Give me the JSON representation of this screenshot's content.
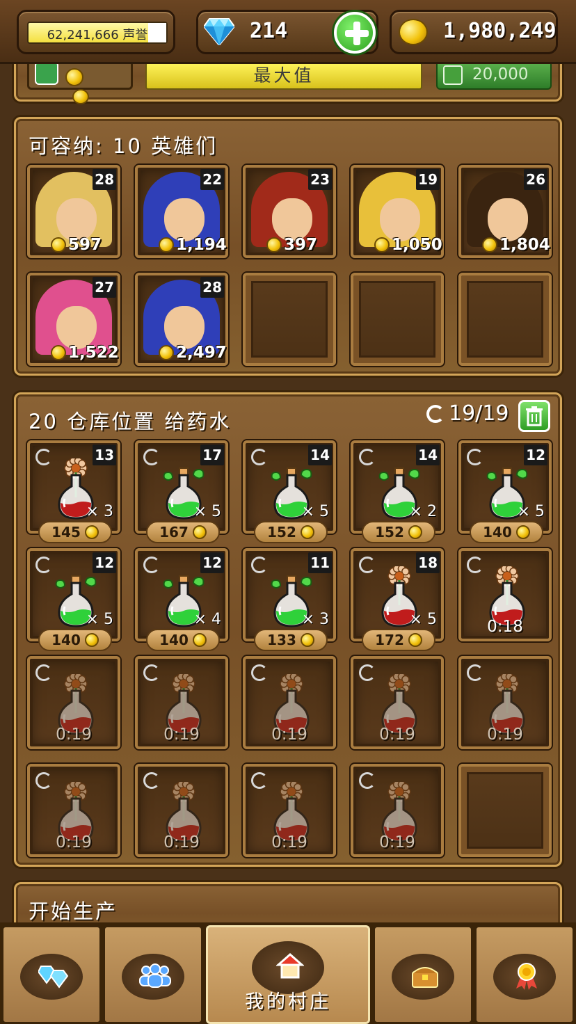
{
  "header": {
    "fame_value": "62,241,666 声誉",
    "gems": "214",
    "gold": "1,980,249"
  },
  "upgrade_strip": {
    "max_label": "最大值",
    "cost_label": "20,000"
  },
  "heroes_panel": {
    "title": "可容纳: 10 英雄们",
    "heroes": [
      {
        "level": "28",
        "price": "597",
        "hair": "#e2c060"
      },
      {
        "level": "22",
        "price": "1,194",
        "hair": "#2f3fb8"
      },
      {
        "level": "23",
        "price": "397",
        "hair": "#a12a1a"
      },
      {
        "level": "19",
        "price": "1,050",
        "hair": "#e8c03a"
      },
      {
        "level": "26",
        "price": "1,804",
        "hair": "#3a2410"
      },
      {
        "level": "27",
        "price": "1,522",
        "hair": "#e0508e"
      },
      {
        "level": "28",
        "price": "2,497",
        "hair": "#2f3fb8"
      }
    ]
  },
  "storage_panel": {
    "title": "20 仓库位置 给药水",
    "count": "19/19",
    "potions": [
      {
        "level": "13",
        "qty": "× 3",
        "price": "145",
        "kind": "red"
      },
      {
        "level": "17",
        "qty": "× 5",
        "price": "167",
        "kind": "green"
      },
      {
        "level": "14",
        "qty": "× 5",
        "price": "152",
        "kind": "green"
      },
      {
        "level": "14",
        "qty": "× 2",
        "price": "152",
        "kind": "green"
      },
      {
        "level": "12",
        "qty": "× 5",
        "price": "140",
        "kind": "green"
      },
      {
        "level": "12",
        "qty": "× 5",
        "price": "140",
        "kind": "green"
      },
      {
        "level": "12",
        "qty": "× 4",
        "price": "140",
        "kind": "green"
      },
      {
        "level": "11",
        "qty": "× 3",
        "price": "133",
        "kind": "green"
      },
      {
        "level": "18",
        "qty": "× 5",
        "price": "172",
        "kind": "red"
      }
    ],
    "brewing": [
      {
        "timer": "0:18",
        "active": true
      },
      {
        "timer": "0:19"
      },
      {
        "timer": "0:19"
      },
      {
        "timer": "0:19"
      },
      {
        "timer": "0:19"
      },
      {
        "timer": "0:19"
      },
      {
        "timer": "0:19"
      },
      {
        "timer": "0:19"
      },
      {
        "timer": "0:19"
      },
      {
        "timer": "0:19"
      }
    ]
  },
  "production_panel": {
    "title": "开始生产"
  },
  "bottom_nav": {
    "active_label": "我的村庄",
    "tabs": [
      {
        "icon": "gems-icon"
      },
      {
        "icon": "heroes-icon"
      },
      {
        "icon": "home-icon"
      },
      {
        "icon": "chest-icon"
      },
      {
        "icon": "medal-icon"
      }
    ]
  },
  "colors": {
    "wood_dark": "#4a3118",
    "wood_light": "#c59b62",
    "gold_border": "#d3a558",
    "potion_red": "#c01c1c",
    "potion_green": "#2fd13a"
  }
}
